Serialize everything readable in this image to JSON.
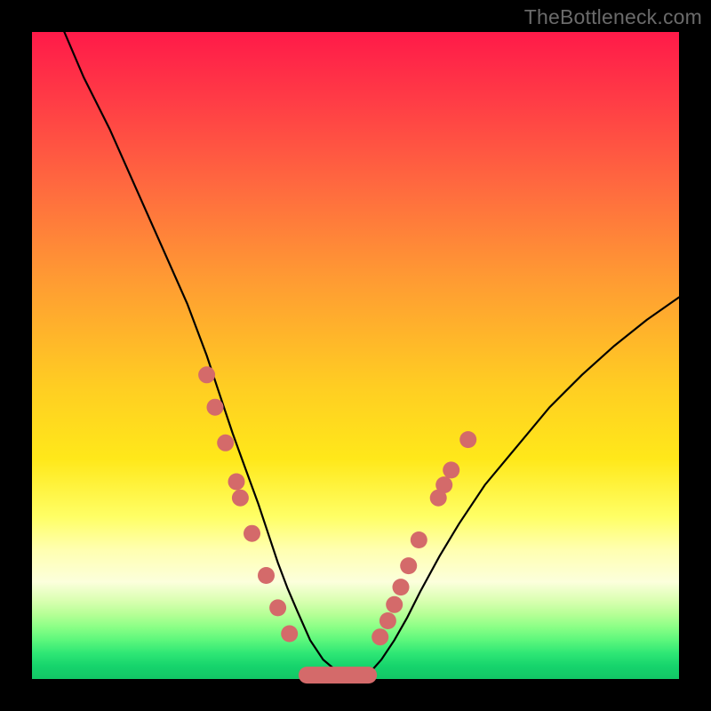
{
  "watermark": "TheBottleneck.com",
  "colors": {
    "frame": "#000000",
    "curve": "#000000",
    "marker": "#d46a6a"
  },
  "chart_data": {
    "type": "line",
    "title": "",
    "xlabel": "",
    "ylabel": "",
    "xlim": [
      0,
      100
    ],
    "ylim": [
      0,
      100
    ],
    "grid": false,
    "legend": false,
    "note": "V-shaped bottleneck curve; values estimated from pixel positions.",
    "series": [
      {
        "name": "curve",
        "x": [
          5,
          8,
          12,
          16,
          20,
          24,
          27,
          29,
          31,
          33,
          35,
          36.5,
          38,
          39.5,
          41,
          43,
          45,
          47,
          49,
          51,
          52.5,
          54,
          56,
          58,
          60,
          63,
          66,
          70,
          75,
          80,
          85,
          90,
          95,
          100
        ],
        "y": [
          100,
          93,
          85,
          76,
          67,
          58,
          50,
          44,
          38,
          32.5,
          27,
          22.5,
          18,
          14,
          10.5,
          6,
          3,
          1.3,
          0.4,
          0.4,
          1.3,
          3,
          6,
          9.5,
          13.5,
          19,
          24,
          30,
          36,
          42,
          47,
          51.5,
          55.5,
          59
        ]
      }
    ],
    "markers_left": [
      {
        "x": 27.0,
        "y": 47.0
      },
      {
        "x": 28.3,
        "y": 42.0
      },
      {
        "x": 29.9,
        "y": 36.5
      },
      {
        "x": 31.6,
        "y": 30.5
      },
      {
        "x": 32.2,
        "y": 28.0
      },
      {
        "x": 34.0,
        "y": 22.5
      },
      {
        "x": 36.2,
        "y": 16.0
      },
      {
        "x": 38.0,
        "y": 11.0
      },
      {
        "x": 39.8,
        "y": 7.0
      }
    ],
    "markers_right": [
      {
        "x": 53.8,
        "y": 6.5
      },
      {
        "x": 55.0,
        "y": 9.0
      },
      {
        "x": 56.0,
        "y": 11.5
      },
      {
        "x": 57.0,
        "y": 14.2
      },
      {
        "x": 58.2,
        "y": 17.5
      },
      {
        "x": 59.8,
        "y": 21.5
      },
      {
        "x": 62.8,
        "y": 28.0
      },
      {
        "x": 63.7,
        "y": 30.0
      },
      {
        "x": 64.8,
        "y": 32.3
      },
      {
        "x": 67.4,
        "y": 37.0
      }
    ],
    "valley_pill": {
      "x_start": 42.5,
      "x_end": 52.0,
      "y": 0.6
    }
  }
}
